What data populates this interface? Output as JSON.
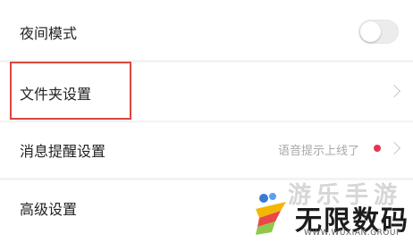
{
  "settings": {
    "night_mode": {
      "label": "夜间模式",
      "enabled": false
    },
    "folder": {
      "label": "文件夹设置"
    },
    "message_reminder": {
      "label": "消息提醒设置",
      "hint": "语音提示上线了"
    },
    "advanced": {
      "label": "高级设置"
    }
  },
  "watermark": {
    "faded_text": "游乐手游",
    "title": "无限数码",
    "url": "WWW.WUXIAN.GROUP"
  },
  "colors": {
    "highlight_border": "#d9463e",
    "notification_dot": "#e8344e",
    "toggle_off": "#ececec",
    "chevron": "#c7c7c7"
  },
  "icons": {
    "chevron": "chevron-right-icon",
    "toggle": "toggle-switch",
    "dot": "notification-dot-icon",
    "logo": "watermark-logo-icon"
  }
}
